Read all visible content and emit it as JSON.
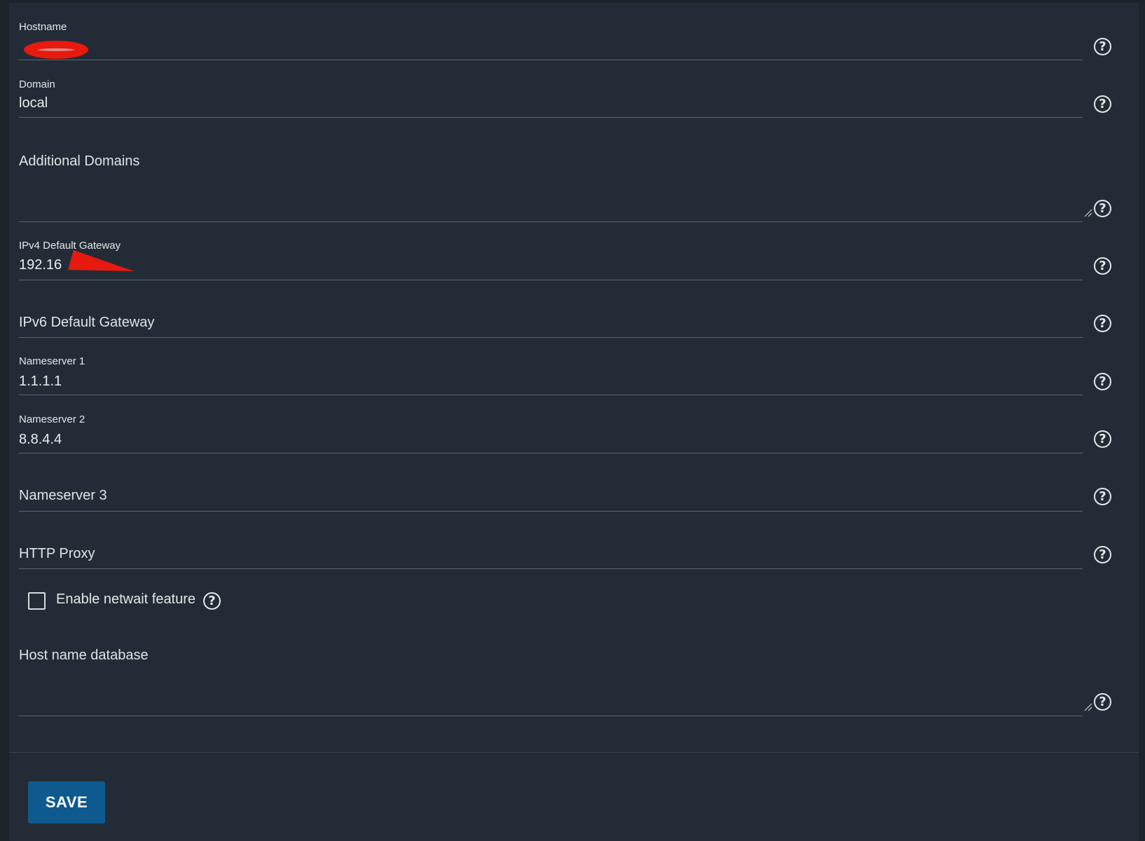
{
  "fields": {
    "hostname": {
      "label": "Hostname",
      "value": ""
    },
    "domain": {
      "label": "Domain",
      "value": "local"
    },
    "additional_domains": {
      "label": "Additional Domains",
      "value": ""
    },
    "ipv4_gateway": {
      "label": "IPv4 Default Gateway",
      "value": "192.16"
    },
    "ipv6_gateway": {
      "label": "IPv6 Default Gateway",
      "value": ""
    },
    "nameserver1": {
      "label": "Nameserver 1",
      "value": "1.1.1.1"
    },
    "nameserver2": {
      "label": "Nameserver 2",
      "value": "8.8.4.4"
    },
    "nameserver3": {
      "label": "Nameserver 3",
      "value": ""
    },
    "http_proxy": {
      "label": "HTTP Proxy",
      "value": ""
    },
    "host_name_database": {
      "label": "Host name database",
      "value": ""
    }
  },
  "netwait": {
    "label": "Enable netwait feature",
    "checked": false
  },
  "help_glyph": "?",
  "save_label": "SAVE",
  "colors": {
    "background": "#232c36",
    "save_button": "#0e5a8e",
    "redaction": "#e8190f"
  }
}
